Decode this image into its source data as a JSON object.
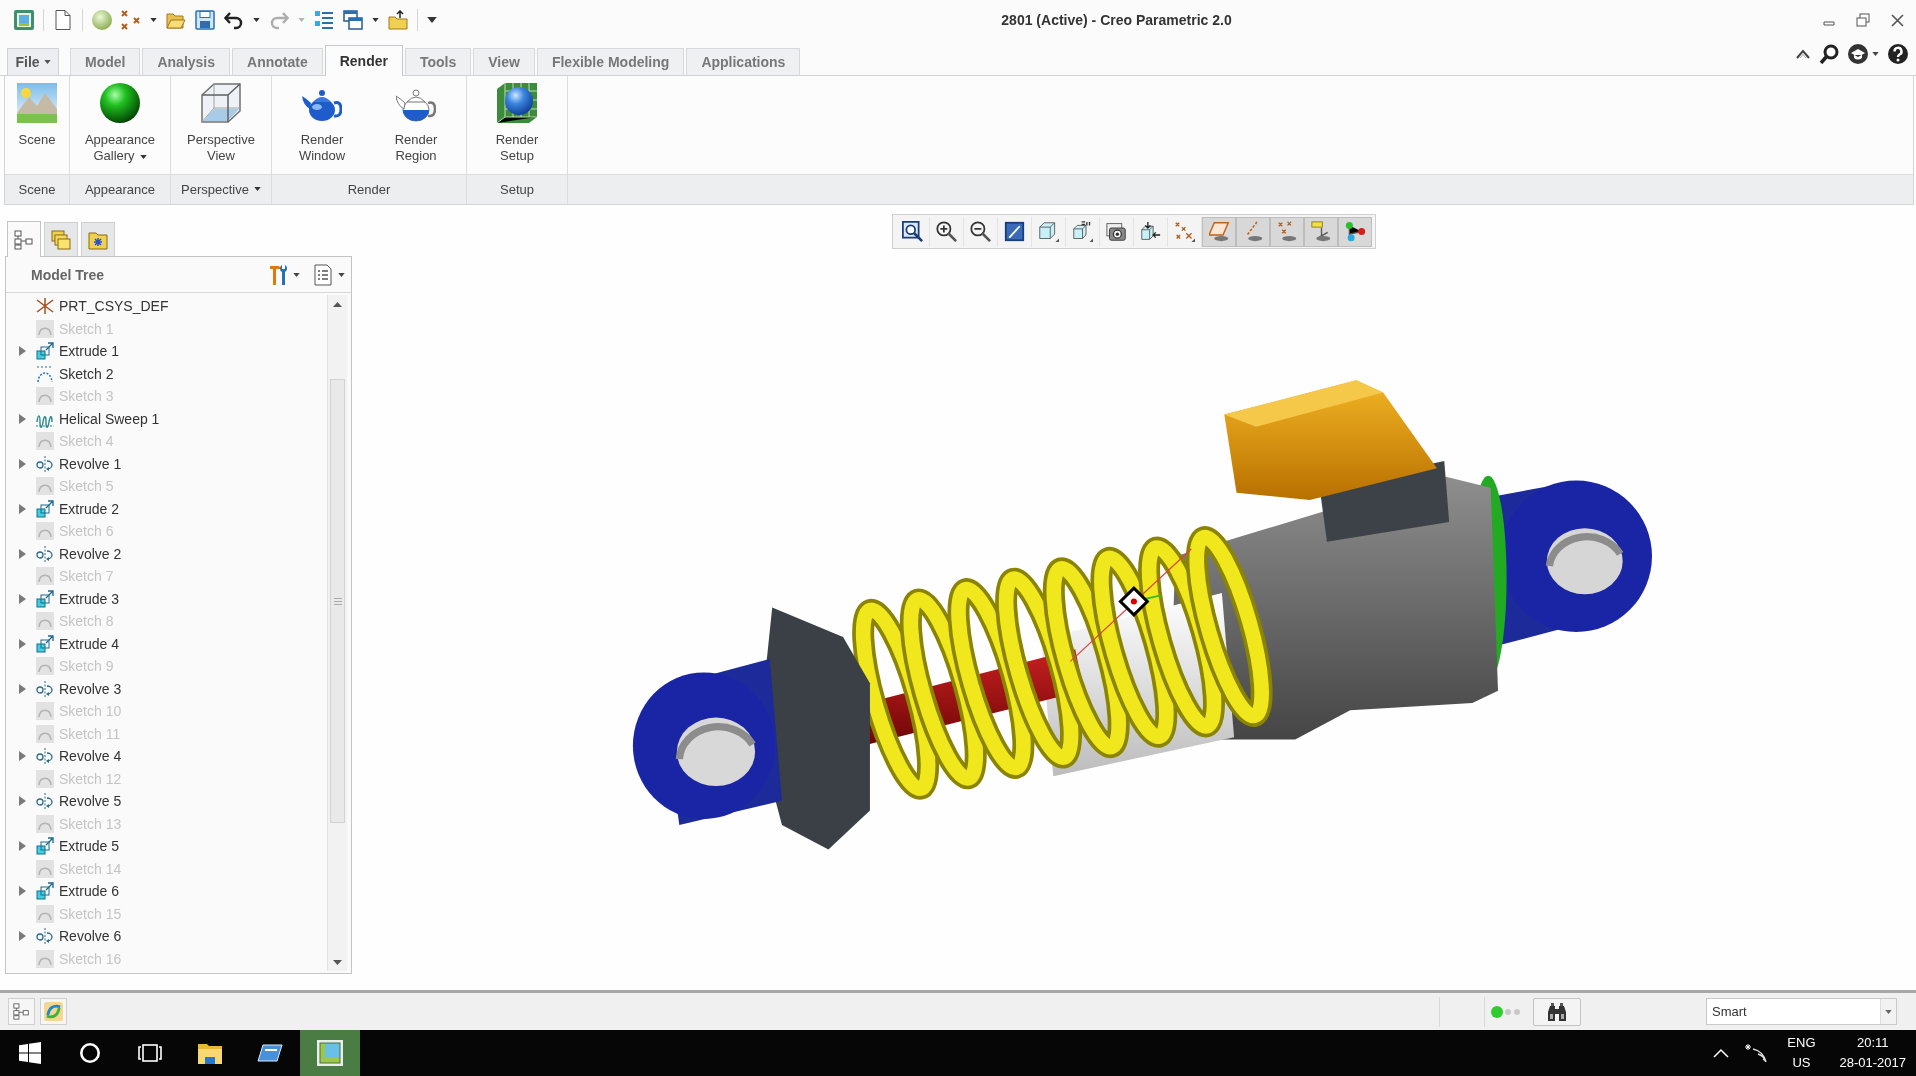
{
  "window": {
    "title": "2801 (Active) - Creo Parametric 2.0"
  },
  "quick_access_toolbar": {
    "buttons": [
      {
        "disabled": false
      },
      {
        "disabled": false
      },
      {
        "disabled": false
      },
      {
        "disabled": false
      },
      {
        "disabled": false
      },
      {
        "disabled": false
      },
      {
        "disabled": false
      },
      {
        "disabled": true
      },
      {
        "disabled": false
      },
      {
        "disabled": false
      },
      {
        "disabled": false
      }
    ]
  },
  "ribbon": {
    "file_menu": {
      "label": "File"
    },
    "tabs": [
      {
        "label": "Model",
        "selected": false
      },
      {
        "label": "Analysis",
        "selected": false
      },
      {
        "label": "Annotate",
        "selected": false
      },
      {
        "label": "Render",
        "selected": true
      },
      {
        "label": "Tools",
        "selected": false
      },
      {
        "label": "View",
        "selected": false
      },
      {
        "label": "Flexible Modeling",
        "selected": false
      },
      {
        "label": "Applications",
        "selected": false
      }
    ],
    "groups": [
      {
        "label": "Scene",
        "dropdown": false,
        "commands": [
          {
            "label": "Scene",
            "dropdown": false
          }
        ]
      },
      {
        "label": "Appearance",
        "dropdown": false,
        "commands": [
          {
            "label": "Appearance Gallery",
            "dropdown": true
          }
        ]
      },
      {
        "label": "Perspective",
        "dropdown": true,
        "commands": [
          {
            "label": "Perspective View",
            "dropdown": false
          }
        ]
      },
      {
        "label": "Render",
        "dropdown": false,
        "commands": [
          {
            "label": "Render Window",
            "dropdown": false
          },
          {
            "label": "Render Region",
            "dropdown": false
          }
        ]
      },
      {
        "label": "Setup",
        "dropdown": false,
        "commands": [
          {
            "label": "Render Setup",
            "dropdown": false
          }
        ]
      }
    ]
  },
  "navigator": {
    "tabs": [
      {
        "selected": true
      },
      {
        "selected": false
      },
      {
        "selected": false
      }
    ]
  },
  "model_tree": {
    "title": "Model Tree",
    "items": [
      {
        "label": "PRT_CSYS_DEF",
        "kind": "csys",
        "expandable": false,
        "dimmed": false
      },
      {
        "label": "Sketch 1",
        "kind": "sketch",
        "expandable": false,
        "dimmed": true
      },
      {
        "label": "Extrude 1",
        "kind": "extrude",
        "expandable": true,
        "dimmed": false
      },
      {
        "label": "Sketch 2",
        "kind": "sketch",
        "expandable": false,
        "dimmed": false
      },
      {
        "label": "Sketch 3",
        "kind": "sketch",
        "expandable": false,
        "dimmed": true
      },
      {
        "label": "Helical Sweep 1",
        "kind": "helical_sweep",
        "expandable": true,
        "dimmed": false
      },
      {
        "label": "Sketch 4",
        "kind": "sketch",
        "expandable": false,
        "dimmed": true
      },
      {
        "label": "Revolve 1",
        "kind": "revolve",
        "expandable": true,
        "dimmed": false
      },
      {
        "label": "Sketch 5",
        "kind": "sketch",
        "expandable": false,
        "dimmed": true
      },
      {
        "label": "Extrude 2",
        "kind": "extrude",
        "expandable": true,
        "dimmed": false
      },
      {
        "label": "Sketch 6",
        "kind": "sketch",
        "expandable": false,
        "dimmed": true
      },
      {
        "label": "Revolve 2",
        "kind": "revolve",
        "expandable": true,
        "dimmed": false
      },
      {
        "label": "Sketch 7",
        "kind": "sketch",
        "expandable": false,
        "dimmed": true
      },
      {
        "label": "Extrude 3",
        "kind": "extrude",
        "expandable": true,
        "dimmed": false
      },
      {
        "label": "Sketch 8",
        "kind": "sketch",
        "expandable": false,
        "dimmed": true
      },
      {
        "label": "Extrude 4",
        "kind": "extrude",
        "expandable": true,
        "dimmed": false
      },
      {
        "label": "Sketch 9",
        "kind": "sketch",
        "expandable": false,
        "dimmed": true
      },
      {
        "label": "Revolve 3",
        "kind": "revolve",
        "expandable": true,
        "dimmed": false
      },
      {
        "label": "Sketch 10",
        "kind": "sketch",
        "expandable": false,
        "dimmed": true
      },
      {
        "label": "Sketch 11",
        "kind": "sketch",
        "expandable": false,
        "dimmed": true
      },
      {
        "label": "Revolve 4",
        "kind": "revolve",
        "expandable": true,
        "dimmed": false
      },
      {
        "label": "Sketch 12",
        "kind": "sketch",
        "expandable": false,
        "dimmed": true
      },
      {
        "label": "Revolve 5",
        "kind": "revolve",
        "expandable": true,
        "dimmed": false
      },
      {
        "label": "Sketch 13",
        "kind": "sketch",
        "expandable": false,
        "dimmed": true
      },
      {
        "label": "Extrude 5",
        "kind": "extrude",
        "expandable": true,
        "dimmed": false
      },
      {
        "label": "Sketch 14",
        "kind": "sketch",
        "expandable": false,
        "dimmed": true
      },
      {
        "label": "Extrude 6",
        "kind": "extrude",
        "expandable": true,
        "dimmed": false
      },
      {
        "label": "Sketch 15",
        "kind": "sketch",
        "expandable": false,
        "dimmed": true
      },
      {
        "label": "Revolve 6",
        "kind": "revolve",
        "expandable": true,
        "dimmed": false
      },
      {
        "label": "Sketch 16",
        "kind": "sketch",
        "expandable": false,
        "dimmed": true
      }
    ]
  },
  "view_toolbar": {
    "buttons": [
      {
        "on": false
      },
      {
        "on": false
      },
      {
        "on": false
      },
      {
        "on": false
      },
      {
        "on": false
      },
      {
        "on": false
      },
      {
        "on": false
      },
      {
        "on": false
      },
      {
        "on": false
      },
      {
        "on": true
      },
      {
        "on": true
      },
      {
        "on": true
      },
      {
        "on": true
      },
      {
        "on": true
      }
    ]
  },
  "status_bar": {
    "filter": {
      "value": "Smart"
    }
  },
  "taskbar": {
    "apps": [
      {
        "selected": false
      },
      {
        "selected": false
      },
      {
        "selected": true
      }
    ],
    "tray": {
      "language": "ENG",
      "region": "US",
      "time": "20:11",
      "date": "28-01-2017"
    }
  }
}
